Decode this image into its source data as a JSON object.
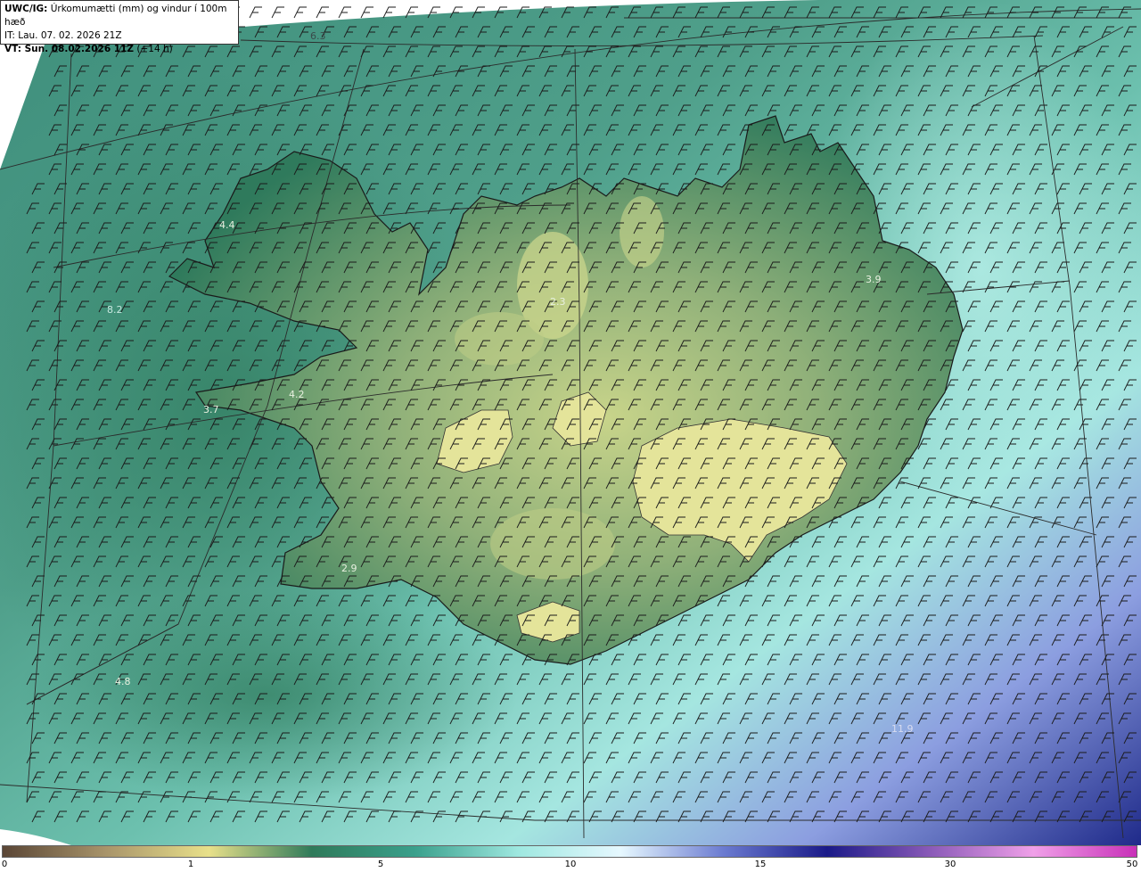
{
  "header": {
    "product": "UWC/IG:",
    "title": "Úrkomumætti (mm) og vindur í 100m hæð",
    "issue_time": "IT: Lau. 07. 02. 2026 21Z",
    "valid_prefix": "VT: Sun. 08.02.2026 11Z",
    "valid_suffix": " (+14 h)"
  },
  "colorbar": {
    "ticks": [
      "0",
      "1",
      "5",
      "10",
      "15",
      "30",
      "50"
    ],
    "colors": [
      "#5a4636",
      "#a8946a",
      "#e8e08a",
      "#2f7a5a",
      "#3aa08c",
      "#9ee8e0",
      "#e6f8ff",
      "#6a7ad0",
      "#1a1a88",
      "#8a5ab8",
      "#f0a0e8",
      "#c830b8"
    ]
  },
  "map": {
    "background_colors": {
      "sea_low": "#3f8f7c",
      "sea_mid": "#5fb3a2",
      "sea_high": "#a5e6e0",
      "blue": "#5b6bc8",
      "deep_blue": "#1f2a8a",
      "land_low": "#2f7a5c",
      "land_high": "#c8d48a"
    },
    "labels": [
      "6.3",
      "4.4",
      "8.2",
      "4.2",
      "3.7",
      "2.9",
      "4.8",
      "2.3",
      "3.9",
      "11.9"
    ]
  }
}
